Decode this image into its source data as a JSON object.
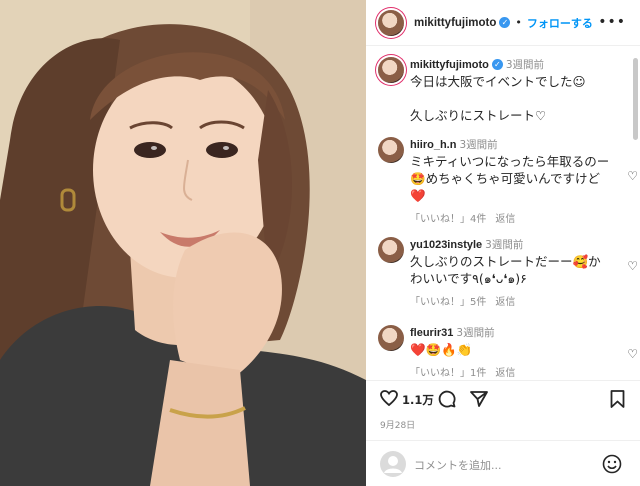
{
  "header": {
    "username": "mikittyfujimoto",
    "separator": "•",
    "follow_label": "フォローする",
    "more_icon": "more-horizontal-icon"
  },
  "comments": [
    {
      "username": "mikittyfujimoto",
      "time": "3週間前",
      "text": "今日は大阪でイベントでした☺︎\n\n久しぶりにストレート♡",
      "verified": true
    },
    {
      "username": "hiiro_h.n",
      "time": "3週間前",
      "text": "ミキティいつになったら年取るのー🤩めちゃくちゃ可愛いんですけど❤️",
      "like_label": "「いいね！」4件",
      "reply_label": "返信"
    },
    {
      "username": "yu1023instyle",
      "time": "3週間前",
      "text": "久しぶりのストレートだーー🥰かわいいです٩(๑❛ᴗ❛๑)۶",
      "like_label": "「いいね！」5件",
      "reply_label": "返信"
    },
    {
      "username": "fleurir31",
      "time": "3週間前",
      "text": "❤️🤩🔥👏",
      "like_label": "「いいね！」1件",
      "reply_label": "返信"
    }
  ],
  "actions": {
    "likes": "1.1万",
    "date": "9月28日"
  },
  "add_comment": {
    "placeholder": "コメントを追加..."
  },
  "colors": {
    "accent": "#0095f6",
    "verified": "#3897f0",
    "muted": "#8e8e8e"
  }
}
